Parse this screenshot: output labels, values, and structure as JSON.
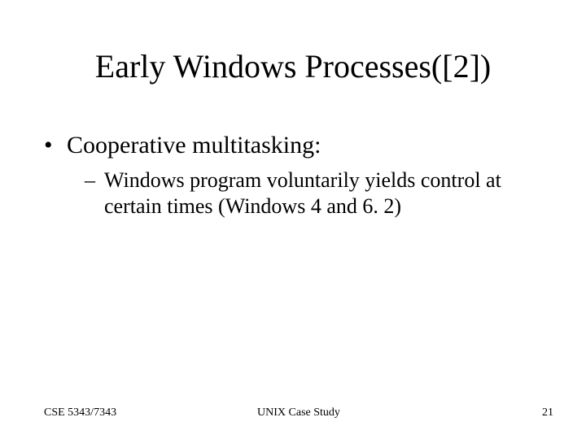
{
  "title": "Early Windows Processes([2])",
  "bullets": {
    "l1": "Cooperative multitasking:",
    "l2": "Windows program voluntarily yields control at certain times (Windows 4 and 6. 2)"
  },
  "footer": {
    "left": "CSE 5343/7343",
    "center": "UNIX Case Study",
    "page": "21"
  }
}
